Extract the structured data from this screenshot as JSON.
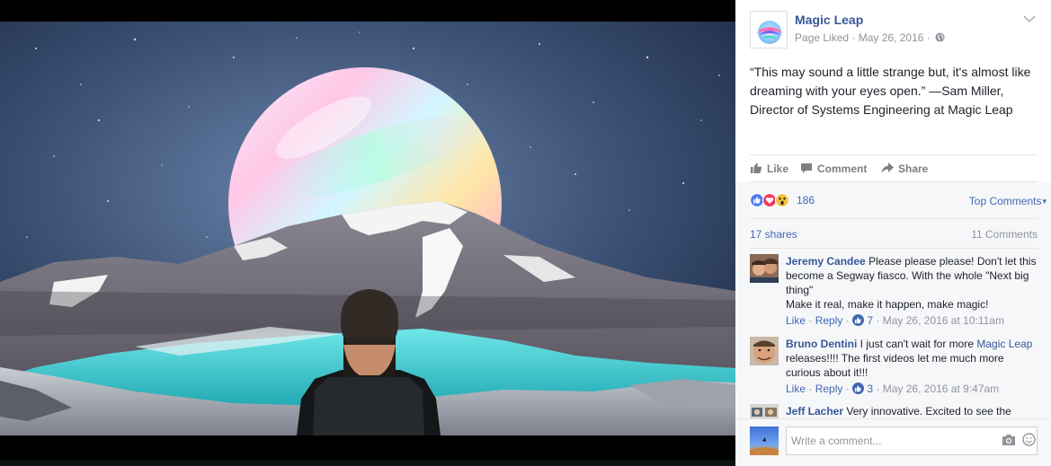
{
  "post": {
    "page_name": "Magic Leap",
    "meta_status": "Page Liked",
    "meta_separator": " · ",
    "meta_date": "May 26, 2016",
    "meta_separator_2": " · ",
    "text": "“This may sound a little strange but, it's almost like dreaming with your eyes open.” —Sam Miller, Director of Systems Engineering at Magic Leap"
  },
  "actions": {
    "like": "Like",
    "comment": "Comment",
    "share": "Share"
  },
  "feedback": {
    "reaction_count": "186",
    "reaction_icons": [
      "like-reaction",
      "love-reaction",
      "wow-reaction"
    ],
    "sort_label": "Top Comments",
    "shares": "17 shares",
    "comments_count": "11 Comments"
  },
  "comments": [
    {
      "author": "Jeremy Candee",
      "text": "Please please please! Don't let this become a Segway fiasco. With the whole \"Next big thing\"",
      "text_2": "Make it real, make it happen, make magic!",
      "like_label": "Like",
      "reply_label": "Reply",
      "like_count": "7",
      "timestamp": "May 26, 2016 at 10:11am"
    },
    {
      "author": "Bruno Dentini",
      "text_before_link": "I just can't wait for more",
      "link_text": "Magic Leap",
      "text_after_link": "releases!!!! The first videos let me much more curious about it!!!",
      "like_label": "Like",
      "reply_label": "Reply",
      "like_count": "3",
      "timestamp": "May 26, 2016 at 9:47am"
    },
    {
      "author": "Jeff Lacher",
      "text": "Very innovative. Excited to see the"
    }
  ],
  "composer": {
    "placeholder": "Write a comment..."
  },
  "colors": {
    "link_blue": "#365899",
    "action_blue": "#4267b2",
    "meta_gray": "#90949c",
    "panel_bg": "#ffffff",
    "feedback_bg": "#f6f7f9"
  }
}
